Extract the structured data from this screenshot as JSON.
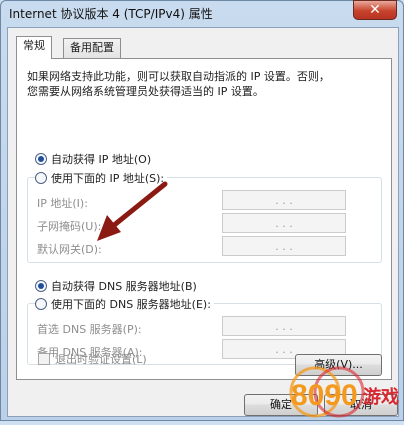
{
  "window": {
    "title": "Internet 协议版本 4 (TCP/IPv4) 属性",
    "close_glyph": "✕"
  },
  "tabs": [
    {
      "label": "常规",
      "active": true
    },
    {
      "label": "备用配置",
      "active": false
    }
  ],
  "description": {
    "line1": "如果网络支持此功能，则可以获取自动指派的 IP 设置。否则，",
    "line2": "您需要从网络系统管理员处获得适当的 IP 设置。"
  },
  "ip_section": {
    "auto_label": "自动获得 IP 地址(O)",
    "auto_selected": true,
    "manual_label": "使用下面的 IP 地址(S):",
    "fields": [
      {
        "label": "IP 地址(I):",
        "value": ". . ."
      },
      {
        "label": "子网掩码(U):",
        "value": ". . ."
      },
      {
        "label": "默认网关(D):",
        "value": ". . ."
      }
    ]
  },
  "dns_section": {
    "auto_label": "自动获得 DNS 服务器地址(B)",
    "auto_selected": true,
    "manual_label": "使用下面的 DNS 服务器地址(E):",
    "fields": [
      {
        "label": "首选 DNS 服务器(P):",
        "value": ". . ."
      },
      {
        "label": "备用 DNS 服务器(A):",
        "value": ". . ."
      }
    ]
  },
  "validate_on_exit": {
    "label": "退出时验证设置(L)",
    "checked": false
  },
  "buttons": {
    "advanced": "高级(V)...",
    "ok": "确定",
    "cancel": "取消"
  },
  "watermark": {
    "text": "8090 游戏",
    "colors": {
      "orange": "#f39a1e",
      "red": "#d8272f"
    }
  },
  "annotation_arrow": {
    "color": "#8b1a12"
  }
}
